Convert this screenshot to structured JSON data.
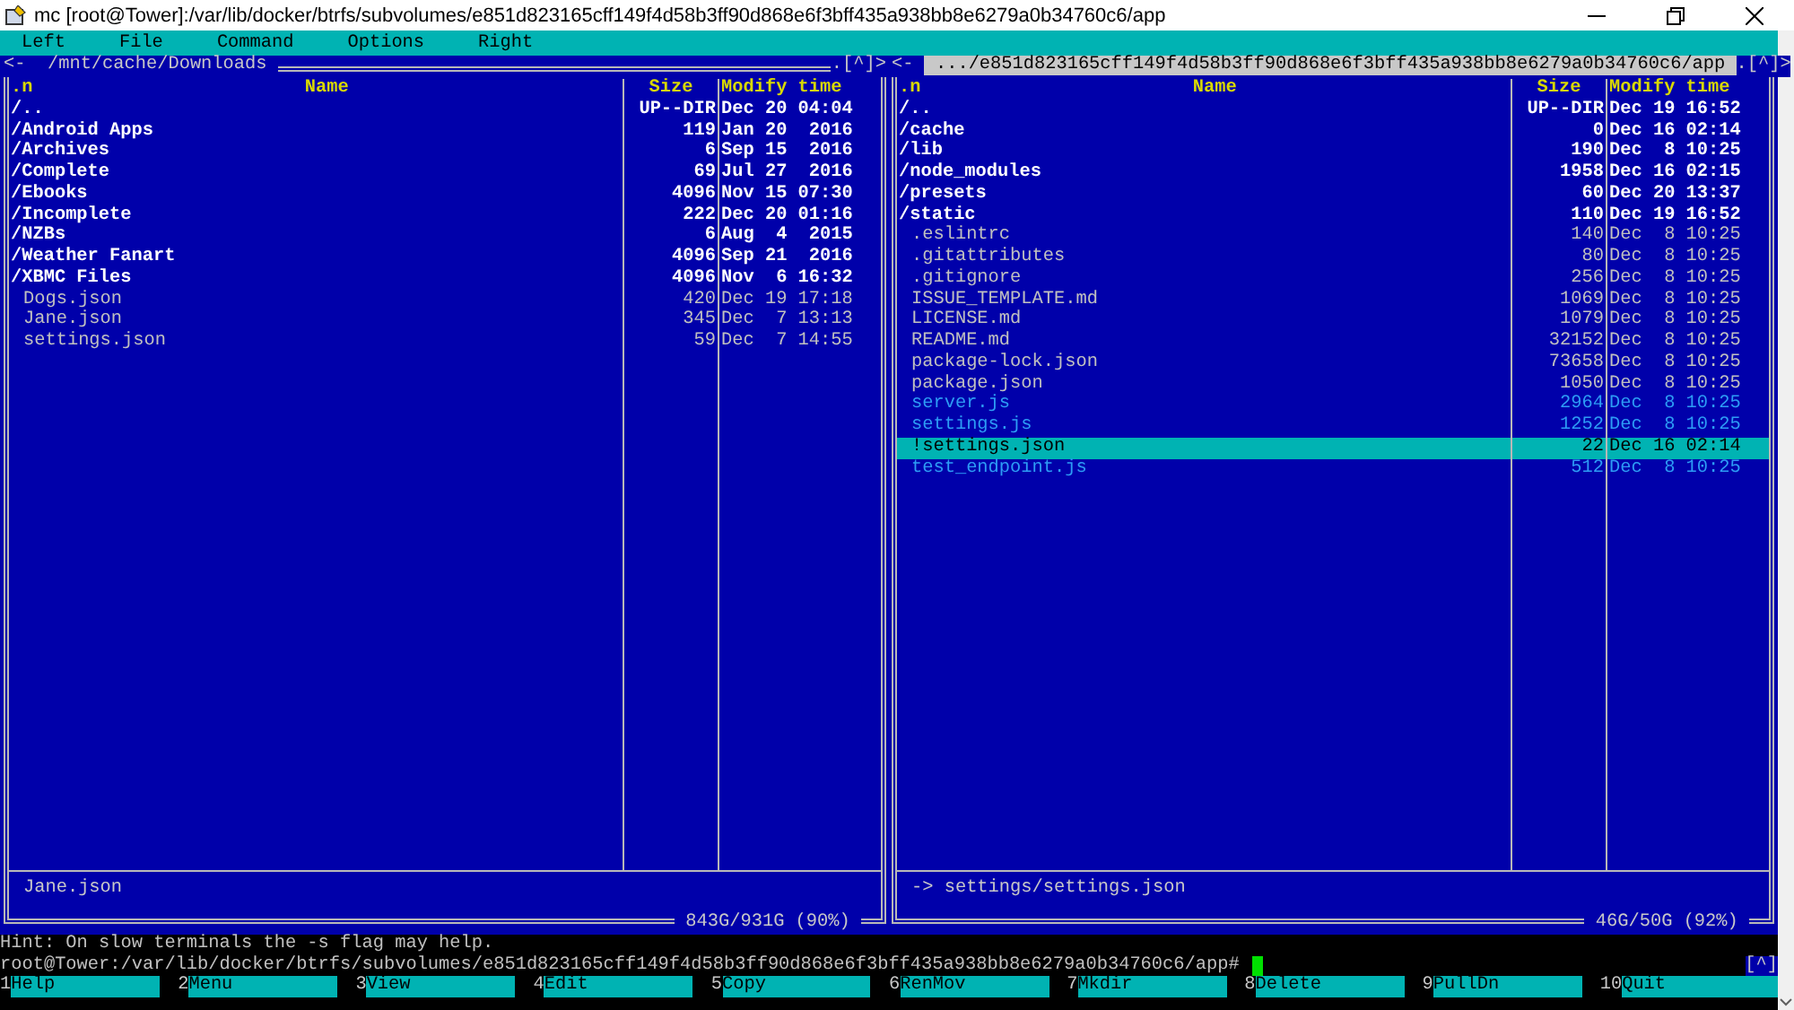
{
  "window": {
    "title": "mc [root@Tower]:/var/lib/docker/btrfs/subvolumes/e851d823165cff149f4d58b3ff90d868e6f3bff435a938bb8e6279a0b34760c6/app"
  },
  "menu": [
    "Left",
    "File",
    "Command",
    "Options",
    "Right"
  ],
  "panels": [
    {
      "nav": "<-",
      "path": "/mnt/cache/Downloads",
      "active": false,
      "corner": ".[^]>",
      "columns": {
        "type": ".n",
        "name": "Name",
        "size": "Size",
        "modified": "Modify time"
      },
      "rows": [
        {
          "name": "/..",
          "size": "UP--DIR",
          "modified": "Dec 20 04:04",
          "kind": "dir",
          "selected": false
        },
        {
          "name": "/Android Apps",
          "size": "119",
          "modified": "Jan 20  2016",
          "kind": "dir",
          "selected": false
        },
        {
          "name": "/Archives",
          "size": "6",
          "modified": "Sep 15  2016",
          "kind": "dir",
          "selected": false
        },
        {
          "name": "/Complete",
          "size": "69",
          "modified": "Jul 27  2016",
          "kind": "dir",
          "selected": false
        },
        {
          "name": "/Ebooks",
          "size": "4096",
          "modified": "Nov 15 07:30",
          "kind": "dir",
          "selected": false
        },
        {
          "name": "/Incomplete",
          "size": "222",
          "modified": "Dec 20 01:16",
          "kind": "dir",
          "selected": false
        },
        {
          "name": "/NZBs",
          "size": "6",
          "modified": "Aug  4  2015",
          "kind": "dir",
          "selected": false
        },
        {
          "name": "/Weather Fanart",
          "size": "4096",
          "modified": "Sep 21  2016",
          "kind": "dir",
          "selected": false
        },
        {
          "name": "/XBMC Files",
          "size": "4096",
          "modified": "Nov  6 16:32",
          "kind": "dir",
          "selected": false
        },
        {
          "name": "Dogs.json",
          "size": "420",
          "modified": "Dec 19 17:18",
          "kind": "file",
          "selected": false
        },
        {
          "name": "Jane.json",
          "size": "345",
          "modified": "Dec  7 13:13",
          "kind": "file",
          "selected": false
        },
        {
          "name": "settings.json",
          "size": "59",
          "modified": "Dec  7 14:55",
          "kind": "file",
          "selected": false
        }
      ],
      "status": "Jane.json",
      "disk": "843G/931G (90%)"
    },
    {
      "nav": "<-",
      "path": ".../e851d823165cff149f4d58b3ff90d868e6f3bff435a938bb8e6279a0b34760c6/app",
      "active": true,
      "corner": ".[^]>",
      "columns": {
        "type": ".n",
        "name": "Name",
        "size": "Size",
        "modified": "Modify time"
      },
      "rows": [
        {
          "name": "/..",
          "size": "UP--DIR",
          "modified": "Dec 19 16:52",
          "kind": "dir",
          "selected": false
        },
        {
          "name": "/cache",
          "size": "0",
          "modified": "Dec 16 02:14",
          "kind": "dir",
          "selected": false
        },
        {
          "name": "/lib",
          "size": "190",
          "modified": "Dec  8 10:25",
          "kind": "dir",
          "selected": false
        },
        {
          "name": "/node_modules",
          "size": "1958",
          "modified": "Dec 16 02:15",
          "kind": "dir",
          "selected": false
        },
        {
          "name": "/presets",
          "size": "60",
          "modified": "Dec 20 13:37",
          "kind": "dir",
          "selected": false
        },
        {
          "name": "/static",
          "size": "110",
          "modified": "Dec 19 16:52",
          "kind": "dir",
          "selected": false
        },
        {
          "name": ".eslintrc",
          "size": "140",
          "modified": "Dec  8 10:25",
          "kind": "file",
          "selected": false
        },
        {
          "name": ".gitattributes",
          "size": "80",
          "modified": "Dec  8 10:25",
          "kind": "file",
          "selected": false
        },
        {
          "name": ".gitignore",
          "size": "256",
          "modified": "Dec  8 10:25",
          "kind": "file",
          "selected": false
        },
        {
          "name": "ISSUE_TEMPLATE.md",
          "size": "1069",
          "modified": "Dec  8 10:25",
          "kind": "file",
          "selected": false
        },
        {
          "name": "LICENSE.md",
          "size": "1079",
          "modified": "Dec  8 10:25",
          "kind": "file",
          "selected": false
        },
        {
          "name": "README.md",
          "size": "32152",
          "modified": "Dec  8 10:25",
          "kind": "file",
          "selected": false
        },
        {
          "name": "package-lock.json",
          "size": "73658",
          "modified": "Dec  8 10:25",
          "kind": "file",
          "selected": false
        },
        {
          "name": "package.json",
          "size": "1050",
          "modified": "Dec  8 10:25",
          "kind": "file",
          "selected": false
        },
        {
          "name": "server.js",
          "size": "2964",
          "modified": "Dec  8 10:25",
          "kind": "exec",
          "selected": false
        },
        {
          "name": "settings.js",
          "size": "1252",
          "modified": "Dec  8 10:25",
          "kind": "exec",
          "selected": false
        },
        {
          "name": "!settings.json",
          "size": "22",
          "modified": "Dec 16 02:14",
          "kind": "link",
          "selected": true
        },
        {
          "name": "test_endpoint.js",
          "size": "512",
          "modified": "Dec  8 10:25",
          "kind": "exec",
          "selected": false
        }
      ],
      "status": "-> settings/settings.json",
      "disk": "46G/50G (92%)"
    }
  ],
  "hint": "Hint: On slow terminals the -s flag may help.",
  "prompt": "root@Tower:/var/lib/docker/btrfs/subvolumes/e851d823165cff149f4d58b3ff90d868e6f3bff435a938bb8e6279a0b34760c6/app#",
  "prompt_corner": "[^]",
  "function_keys": [
    {
      "num": "1",
      "label": "Help"
    },
    {
      "num": "2",
      "label": "Menu"
    },
    {
      "num": "3",
      "label": "View"
    },
    {
      "num": "4",
      "label": "Edit"
    },
    {
      "num": "5",
      "label": "Copy"
    },
    {
      "num": "6",
      "label": "RenMov"
    },
    {
      "num": "7",
      "label": "Mkdir"
    },
    {
      "num": "8",
      "label": "Delete"
    },
    {
      "num": "9",
      "label": "PullDn"
    },
    {
      "num": "10",
      "label": "Quit"
    }
  ]
}
